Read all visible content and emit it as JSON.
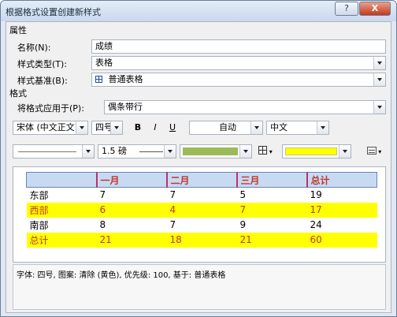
{
  "window": {
    "title": "根据格式设置创建新样式",
    "help_label": "?",
    "close_label": "X"
  },
  "properties": {
    "section_label": "属性",
    "name_label": "名称(N):",
    "name_value": "成绩",
    "type_label": "样式类型(T):",
    "type_value": "表格",
    "base_label": "样式基准(B):",
    "base_value": "普通表格",
    "base_icon": "table-grid-icon"
  },
  "format": {
    "section_label": "格式",
    "apply_label": "将格式应用于(P):",
    "apply_value": "偶条带行",
    "font_value": "宋体 (中文正文)",
    "size_value": "四号",
    "bold_label": "B",
    "italic_label": "I",
    "underline_label": "U",
    "color_value": "自动",
    "lang_value": "中文",
    "border_width": "1.5 磅",
    "border_color": "#9bbb59",
    "shading_color": "#ffff00"
  },
  "preview": {
    "header": [
      "",
      "一月",
      "二月",
      "三月",
      "总计"
    ],
    "rows": [
      {
        "cells": [
          "东部",
          "7",
          "7",
          "5",
          "19"
        ],
        "style": "plain"
      },
      {
        "cells": [
          "西部",
          "6",
          "4",
          "7",
          "17"
        ],
        "style": "band"
      },
      {
        "cells": [
          "南部",
          "8",
          "7",
          "9",
          "24"
        ],
        "style": "plain"
      },
      {
        "cells": [
          "总计",
          "21",
          "18",
          "21",
          "60"
        ],
        "style": "band"
      }
    ]
  },
  "description": "字体: 四号, 图案: 清除 (黄色), 优先级: 100, 基于: 普通表格"
}
